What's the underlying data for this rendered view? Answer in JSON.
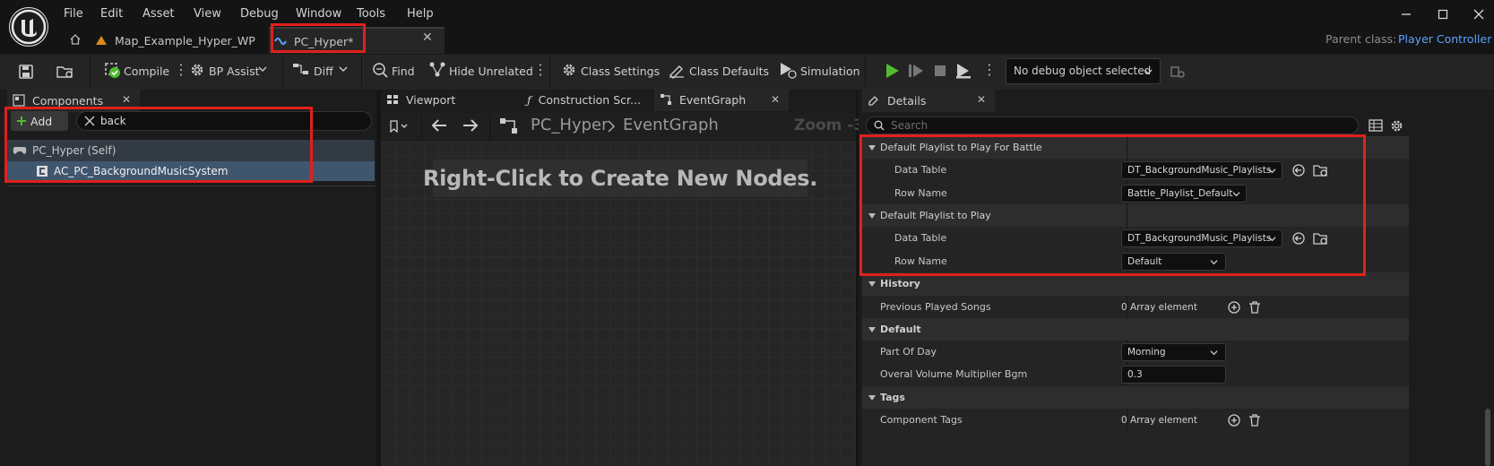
{
  "menu": [
    "File",
    "Edit",
    "Asset",
    "View",
    "Debug",
    "Window",
    "Tools",
    "Help"
  ],
  "tabs": {
    "map": "Map_Example_Hyper_WP",
    "blueprint": "PC_Hyper*"
  },
  "parent_class": {
    "label": "Parent class:",
    "value": "Player Controller"
  },
  "toolbar": {
    "compile": "Compile",
    "bp_assist": "BP Assist",
    "diff": "Diff",
    "find": "Find",
    "hide_unrelated": "Hide Unrelated",
    "class_settings": "Class Settings",
    "class_defaults": "Class Defaults",
    "simulation": "Simulation",
    "debug_object": "No debug object selected"
  },
  "components": {
    "tab": "Components",
    "add": "Add",
    "search_value": "back",
    "root": "PC_Hyper (Self)",
    "child": "AC_PC_BackgroundMusicSystem"
  },
  "graph": {
    "tabs": [
      "Viewport",
      "Construction Scr...",
      "EventGraph"
    ],
    "breadcrumb_root": "PC_Hyper",
    "breadcrumb_leaf": "EventGraph",
    "zoom": "Zoom -3",
    "hint": "Right-Click to Create New Nodes."
  },
  "details": {
    "tab": "Details",
    "search_placeholder": "Search",
    "battle_group": "Default Playlist to Play For Battle",
    "battle_data_table_label": "Data Table",
    "battle_data_table": "DT_BackgroundMusic_Playlists",
    "battle_row_name_label": "Row Name",
    "battle_row_name": "Battle_Playlist_Default",
    "play_group": "Default Playlist to Play",
    "play_data_table_label": "Data Table",
    "play_data_table": "DT_BackgroundMusic_Playlists",
    "play_row_name_label": "Row Name",
    "play_row_name": "Default",
    "history_cat": "History",
    "previous_songs_label": "Previous Played Songs",
    "previous_songs_value": "0 Array element",
    "default_cat": "Default",
    "part_of_day_label": "Part Of Day",
    "part_of_day_value": "Morning",
    "volume_label": "Overal Volume Multiplier Bgm",
    "volume_value": "0.3",
    "tags_cat": "Tags",
    "component_tags_label": "Component Tags",
    "component_tags_value": "0 Array element"
  },
  "colors": {
    "highlight": "#e0201c",
    "play_green": "#4fbd2f",
    "accent_blue": "#5da1ff",
    "map_orange": "#d98a1c"
  }
}
